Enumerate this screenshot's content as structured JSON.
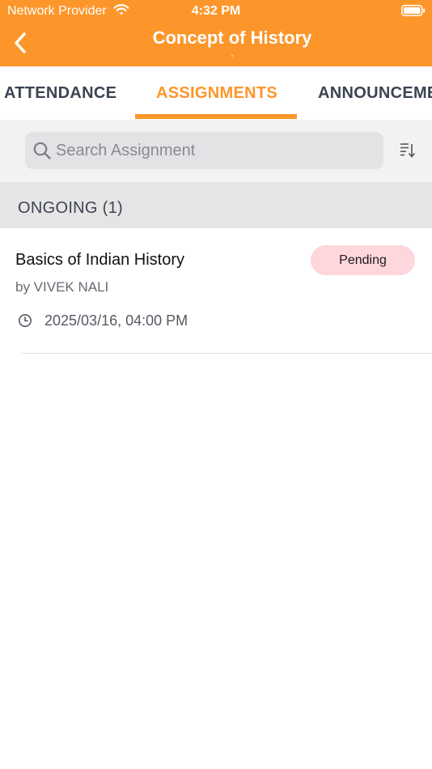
{
  "status_bar": {
    "carrier": "Network Provider",
    "time": "4:32 PM",
    "wifi_icon": "wifi-icon",
    "battery_icon": "battery-icon"
  },
  "header": {
    "title": "Concept of History",
    "back_icon": "chevron-left-icon",
    "background_color": "#FC962A"
  },
  "tabs": [
    {
      "label": "ATTENDANCE",
      "active": false
    },
    {
      "label": "ASSIGNMENTS",
      "active": true
    },
    {
      "label": "ANNOUNCEMENTS",
      "active": false
    }
  ],
  "search": {
    "placeholder": "Search Assignment",
    "value": "",
    "search_icon": "search-icon",
    "sort_icon": "sort-icon"
  },
  "section": {
    "title": "ONGOING (1)"
  },
  "assignments": [
    {
      "title": "Basics of Indian History",
      "author": "by VIVEK NALI",
      "due": "2025/03/16, 04:00 PM",
      "status": "Pending",
      "status_color": "#FDD7DC"
    }
  ],
  "colors": {
    "accent": "#FC962A",
    "tab_text": "#3B4453"
  }
}
